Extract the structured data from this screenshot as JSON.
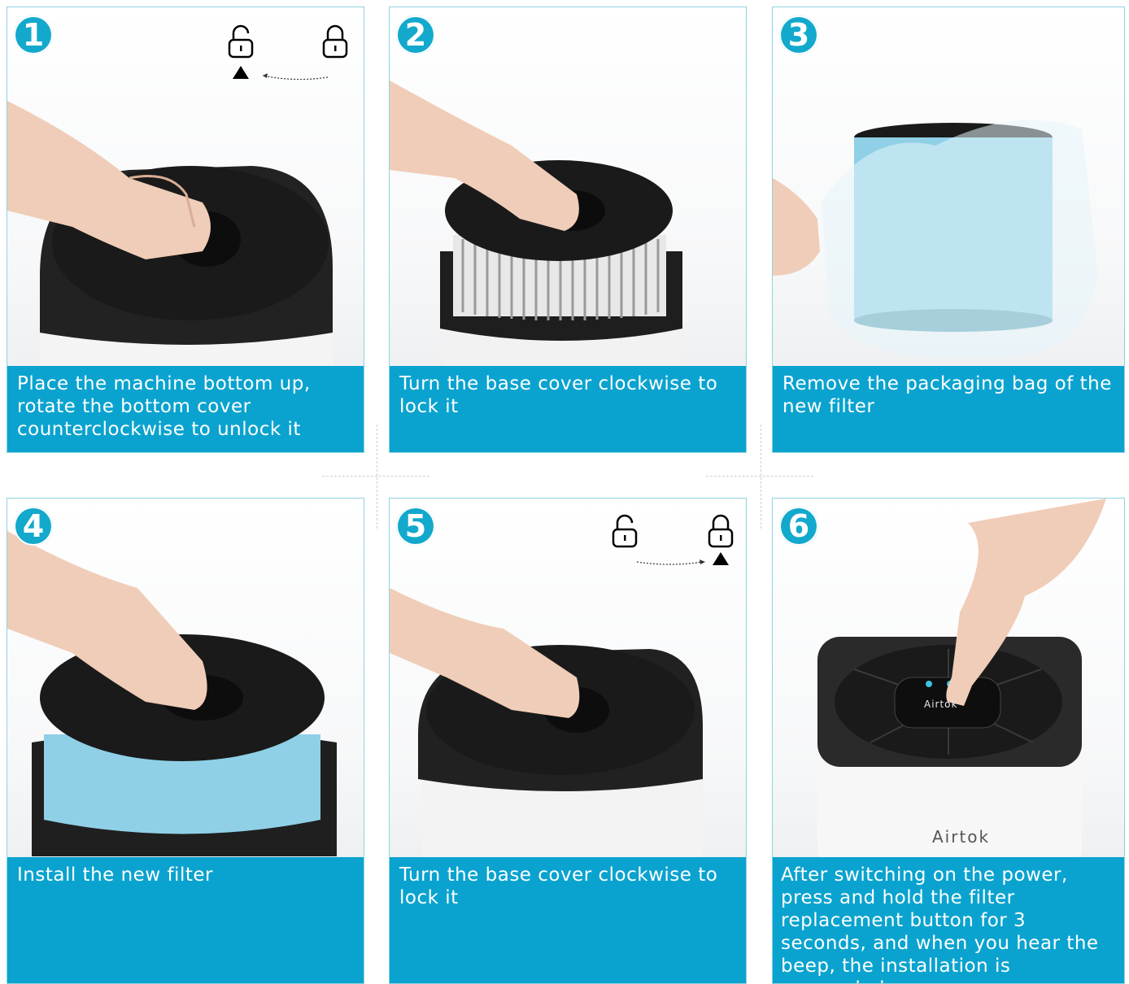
{
  "steps": [
    {
      "number": "1",
      "caption": "Place the machine bottom up, rotate the bottom cover counterclockwise to unlock it"
    },
    {
      "number": "2",
      "caption": "Turn the base cover clockwise to lock it"
    },
    {
      "number": "3",
      "caption": "Remove the packaging bag of the new filter"
    },
    {
      "number": "4",
      "caption": "Install the new filter"
    },
    {
      "number": "5",
      "caption": "Turn the base cover clockwise to lock it"
    },
    {
      "number": "6",
      "caption": "After switching on the power, press and hold the filter replacement button for 3 seconds, and when you hear the beep, the installation is succeeded"
    }
  ],
  "brand": {
    "logo_text": "Airtok",
    "panel_text": "Airtok"
  },
  "colors": {
    "accent": "#0aa3cf",
    "badge": "#13a9cc",
    "filter_blue": "#8fd0e6",
    "cover": "#1b1b1b"
  }
}
